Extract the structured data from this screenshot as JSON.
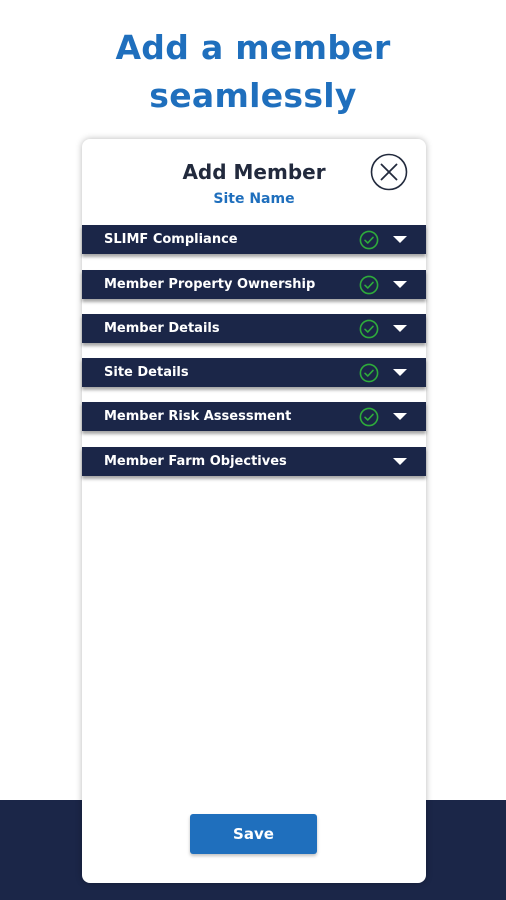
{
  "headline": {
    "line1": "Add a member",
    "line2": "seamlessly"
  },
  "dialog": {
    "title": "Add Member",
    "subtitle": "Site Name",
    "close_icon": "close-circle-icon",
    "sections": [
      {
        "label": "SLIMF Compliance",
        "complete": true
      },
      {
        "label": "Member Property Ownership",
        "complete": true
      },
      {
        "label": "Member Details",
        "complete": true
      },
      {
        "label": "Site Details",
        "complete": true
      },
      {
        "label": "Member Risk Assessment",
        "complete": true
      },
      {
        "label": "Member Farm Objectives",
        "complete": false
      }
    ],
    "save_label": "Save"
  },
  "colors": {
    "accent": "#1f6fbd",
    "navy": "#1b2648",
    "check_green": "#2eab3b"
  }
}
